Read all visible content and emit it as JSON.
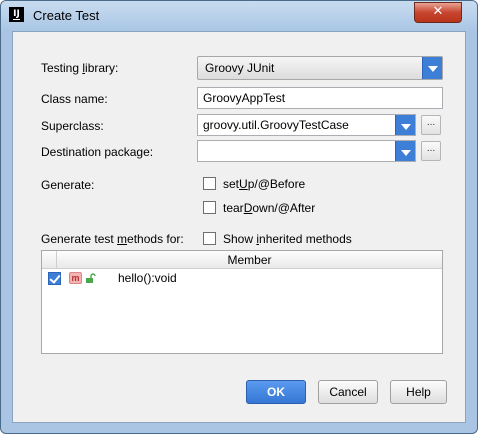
{
  "window": {
    "title": "Create Test",
    "app_icon_text": "IJ",
    "close_glyph": "✕"
  },
  "form": {
    "testing_library": {
      "label_pre": "Testing ",
      "label_u": "l",
      "label_post": "ibrary:",
      "value": "Groovy JUnit"
    },
    "class_name": {
      "label": "Class name:",
      "value": "GroovyAppTest"
    },
    "superclass": {
      "label": "Superclass:",
      "value": "groovy.util.GroovyTestCase",
      "browse": "..."
    },
    "destination_package": {
      "label": "Destination package:",
      "value": "",
      "browse": "..."
    },
    "generate": {
      "label": "Generate:",
      "setup": {
        "pre": "set",
        "u": "U",
        "post": "p/@Before",
        "checked": false
      },
      "teardown": {
        "pre": "tear",
        "u": "D",
        "post": "own/@After",
        "checked": false
      }
    },
    "methods": {
      "label_pre": "Generate test ",
      "label_u": "m",
      "label_post": "ethods for:",
      "show_inherited": {
        "pre": "Show ",
        "u": "i",
        "post": "nherited methods",
        "checked": false
      }
    }
  },
  "table": {
    "columns": [
      "Member"
    ],
    "rows": [
      {
        "checked": true,
        "icon": "m",
        "name": "hello():void"
      }
    ]
  },
  "buttons": {
    "ok": "OK",
    "cancel": "Cancel",
    "help": "Help"
  },
  "colors": {
    "accent": "#3d7ed6",
    "window_frame": "#a9c5e3",
    "close_button": "#c7452f"
  }
}
